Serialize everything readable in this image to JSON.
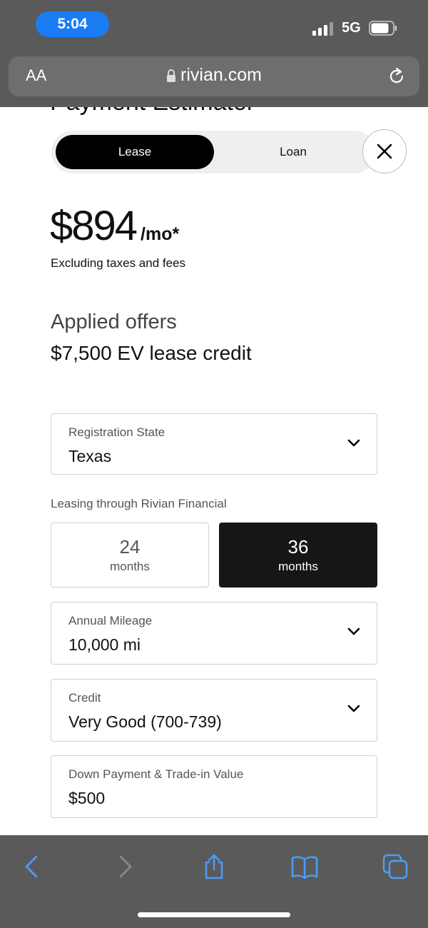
{
  "status": {
    "time": "5:04",
    "network": "5G"
  },
  "browser": {
    "text_size_label": "AA",
    "url": "rivian.com"
  },
  "page": {
    "title": "Payment Estimator",
    "tabs": [
      {
        "label": "Lease",
        "selected": true
      },
      {
        "label": "Loan",
        "selected": false
      }
    ],
    "price": {
      "amount": "$894",
      "unit": "/mo*",
      "note": "Excluding taxes and fees"
    },
    "offers": {
      "title": "Applied offers",
      "value": "$7,500 EV lease credit"
    },
    "registration": {
      "label": "Registration State",
      "value": "Texas"
    },
    "leasing_label": "Leasing through Rivian Financial",
    "terms": [
      {
        "number": "24",
        "unit": "months",
        "selected": false
      },
      {
        "number": "36",
        "unit": "months",
        "selected": true
      }
    ],
    "mileage": {
      "label": "Annual Mileage",
      "value": "10,000 mi"
    },
    "credit": {
      "label": "Credit",
      "value": "Very Good (700-739)"
    },
    "down_payment": {
      "label": "Down Payment & Trade-in Value",
      "value": "$500"
    }
  },
  "colors": {
    "accent_blue": "#1a7cf5",
    "chrome_gray": "#5a5a5a",
    "selected_black": "#000000",
    "toolbar_blue": "#4a9cf7"
  },
  "icons": [
    "lock-icon",
    "reload-icon",
    "close-icon",
    "chevron-down-icon",
    "back-icon",
    "forward-icon",
    "share-icon",
    "bookmarks-icon",
    "tabs-icon"
  ]
}
